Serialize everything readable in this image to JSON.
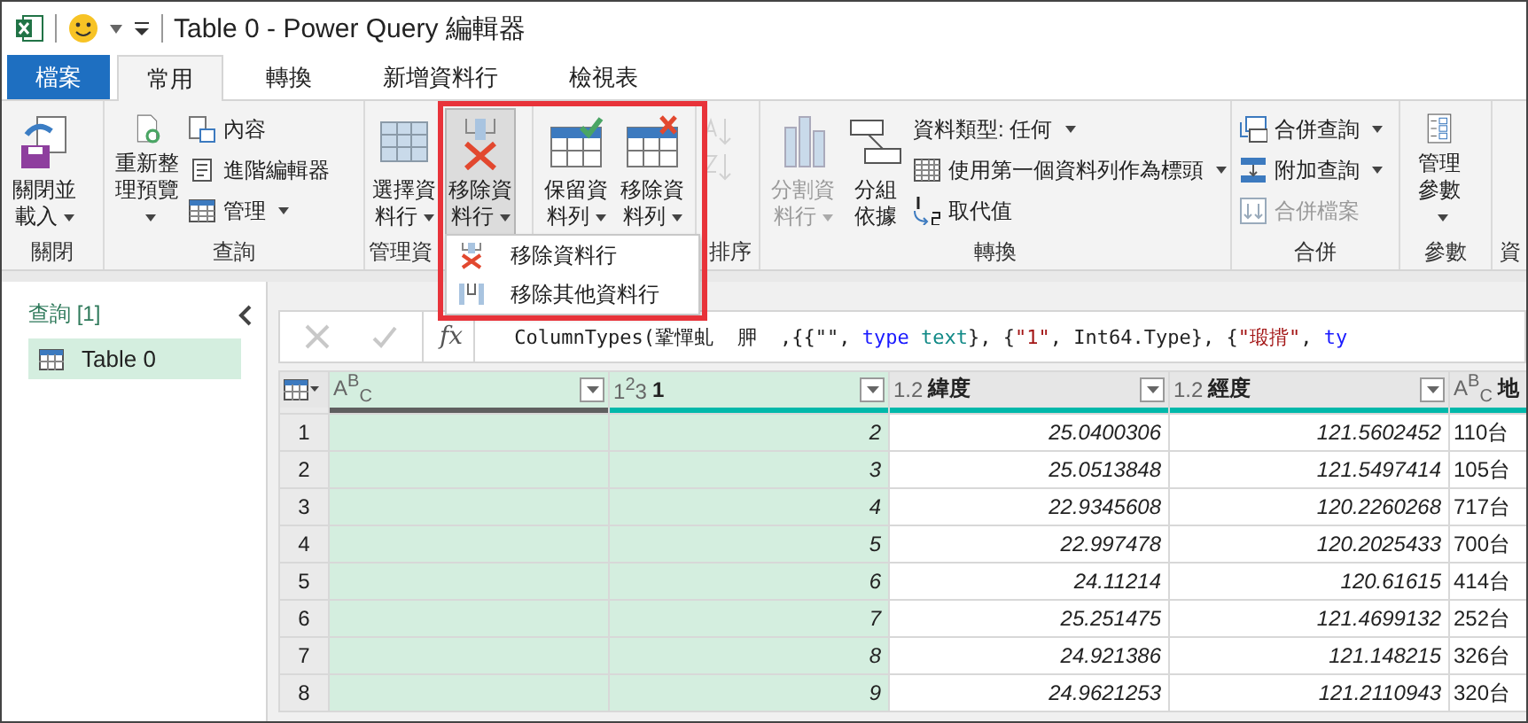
{
  "window": {
    "title": "Table 0 - Power Query 編輯器"
  },
  "tabs": [
    {
      "label": "檔案",
      "kind": "file",
      "selected": false
    },
    {
      "label": "常用",
      "kind": "tab",
      "selected": true
    },
    {
      "label": "轉換",
      "kind": "tab",
      "selected": false
    },
    {
      "label": "新增資料行",
      "kind": "tab",
      "selected": false
    },
    {
      "label": "檢視表",
      "kind": "tab",
      "selected": false
    }
  ],
  "ribbon": {
    "groups": [
      {
        "label": "關閉",
        "items": [
          {
            "kind": "large",
            "label": "關閉並載入",
            "dropdown": true,
            "disabled": false,
            "pressed": false
          }
        ]
      },
      {
        "label": "查詢",
        "items": [
          {
            "kind": "large",
            "label": "重新整理預覽",
            "dropdown": true,
            "disabled": false,
            "pressed": false
          },
          {
            "kind": "small",
            "label": "內容",
            "dropdown": false,
            "disabled": false,
            "pressed": false
          },
          {
            "kind": "small",
            "label": "進階編輯器",
            "dropdown": false,
            "disabled": false,
            "pressed": false
          },
          {
            "kind": "small",
            "label": "管理",
            "dropdown": true,
            "disabled": false,
            "pressed": false
          }
        ]
      },
      {
        "label": "管理資",
        "items": [
          {
            "kind": "large",
            "label": "選擇資料行",
            "dropdown": true,
            "disabled": false,
            "pressed": false
          },
          {
            "kind": "large",
            "label": "移除資料行",
            "dropdown": true,
            "disabled": false,
            "pressed": true
          }
        ]
      },
      {
        "items": [
          {
            "kind": "large",
            "label": "保留資料列",
            "dropdown": true,
            "disabled": false,
            "pressed": false
          },
          {
            "kind": "large",
            "label": "移除資料列",
            "dropdown": true,
            "disabled": false,
            "pressed": false
          }
        ]
      },
      {
        "label": "排序",
        "items": [
          {
            "kind": "icon",
            "disabled": true,
            "pressed": false
          },
          {
            "kind": "icon",
            "disabled": true,
            "pressed": false
          }
        ]
      },
      {
        "label": "轉換",
        "items": [
          {
            "kind": "large",
            "label": "分割資料行",
            "dropdown": true,
            "disabled": true,
            "pressed": false
          },
          {
            "kind": "large",
            "label": "分組依據",
            "dropdown": false,
            "disabled": false,
            "pressed": false
          },
          {
            "kind": "small",
            "label": "資料類型: 任何",
            "dropdown": true,
            "disabled": false,
            "pressed": false
          },
          {
            "kind": "small",
            "label": "使用第一個資料列作為標頭",
            "dropdown": true,
            "disabled": false,
            "pressed": false
          },
          {
            "kind": "small",
            "label": "取代值",
            "dropdown": false,
            "disabled": false,
            "pressed": false
          }
        ]
      },
      {
        "label": "合併",
        "items": [
          {
            "kind": "small",
            "label": "合併查詢",
            "dropdown": true,
            "disabled": false,
            "pressed": false
          },
          {
            "kind": "small",
            "label": "附加查詢",
            "dropdown": true,
            "disabled": false,
            "pressed": false
          },
          {
            "kind": "small",
            "label": "合併檔案",
            "dropdown": false,
            "disabled": true,
            "pressed": false
          }
        ]
      },
      {
        "label": "參數",
        "items": [
          {
            "kind": "large",
            "label": "管理參數",
            "dropdown": true,
            "disabled": false,
            "pressed": false
          }
        ]
      },
      {
        "label": "資"
      }
    ]
  },
  "menu": {
    "items": [
      {
        "label": "移除資料行"
      },
      {
        "label": "移除其他資料行"
      }
    ]
  },
  "queries": {
    "title": "查詢 [1]",
    "items": [
      {
        "label": "Table 0",
        "selected": true
      }
    ]
  },
  "formula": {
    "fx": "fx",
    "segments": [
      {
        "text": "ColumnTypes(鞏憚虬  胛  ,{{\"\", ",
        "kind": "plain"
      },
      {
        "text": "type",
        "kind": "keyword"
      },
      {
        "text": " text",
        "kind": "type"
      },
      {
        "text": "}, {",
        "kind": "plain"
      },
      {
        "text": "\"1\"",
        "kind": "string"
      },
      {
        "text": ", Int64.Type}, {",
        "kind": "plain"
      },
      {
        "text": "\"瑖揹\"",
        "kind": "string"
      },
      {
        "text": ", ",
        "kind": "plain"
      },
      {
        "text": "ty",
        "kind": "keyword"
      }
    ]
  },
  "table": {
    "columns": [
      {
        "type": "A$^{B}$$_{C}$",
        "selected": true,
        "color": "#5f5f5f"
      },
      {
        "type": "1$^{2}$3",
        "name": "1",
        "selected": true,
        "color": "#01b8aa"
      },
      {
        "type": "1.2",
        "name": "緯度",
        "selected": false,
        "color": "#01b8aa"
      },
      {
        "type": "1.2",
        "name": "經度",
        "selected": false,
        "color": "#01b8aa"
      },
      {
        "type": "A$^{B}$$_{C}$",
        "name": "地",
        "selected": false,
        "color": "#01b8aa"
      }
    ],
    "rows": [
      {
        "number": "1",
        "cells": [
          null,
          "2",
          "25.0400306",
          "121.5602452",
          "110台"
        ]
      },
      {
        "number": "2",
        "cells": [
          null,
          "3",
          "25.0513848",
          "121.5497414",
          "105台"
        ]
      },
      {
        "number": "3",
        "cells": [
          null,
          "4",
          "22.9345608",
          "120.2260268",
          "717台"
        ]
      },
      {
        "number": "4",
        "cells": [
          null,
          "5",
          "22.997478",
          "120.2025433",
          "700台"
        ]
      },
      {
        "number": "5",
        "cells": [
          null,
          "6",
          "24.11214",
          "120.61615",
          "414台"
        ]
      },
      {
        "number": "6",
        "cells": [
          null,
          "7",
          "25.251475",
          "121.4699132",
          "252台"
        ]
      },
      {
        "number": "7",
        "cells": [
          null,
          "8",
          "24.921386",
          "121.148215",
          "326台"
        ]
      },
      {
        "number": "8",
        "cells": [
          null,
          "9",
          "24.9621253",
          "121.2110943",
          "320台"
        ]
      }
    ]
  }
}
